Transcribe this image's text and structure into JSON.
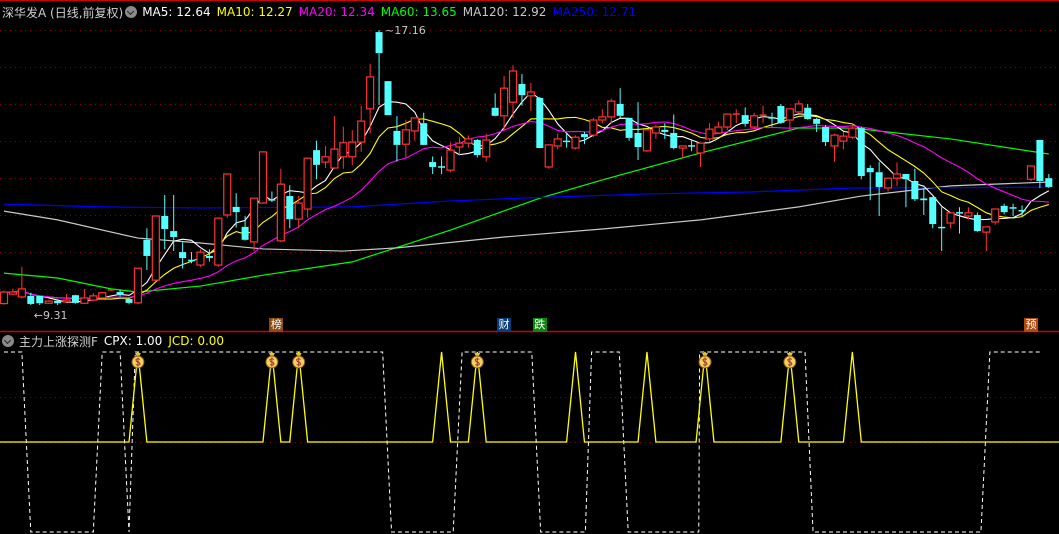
{
  "header": {
    "title": "深华发A (日线,前复权)",
    "ma_labels": [
      {
        "text": "MA5: 12.64",
        "color": "#ffffff"
      },
      {
        "text": "MA10: 12.27",
        "color": "#ffff00"
      },
      {
        "text": "MA20: 12.34",
        "color": "#ff00ff"
      },
      {
        "text": "MA60: 13.65",
        "color": "#00ff00"
      },
      {
        "text": "MA120: 12.92",
        "color": "#c8c8c8"
      },
      {
        "text": "MA250: 12.71",
        "color": "#0000ff"
      }
    ]
  },
  "indicator_header": {
    "title": "主力上涨探测F",
    "cpx": "CPX: 1.00",
    "jcd": "JCD: 0.00"
  },
  "annotations": {
    "high_label": "17.16",
    "low_label": "9.31"
  },
  "event_marks": [
    {
      "text": "榜",
      "color": "#8b4a10",
      "index": 30.5
    },
    {
      "text": "财",
      "color": "#0a3c78",
      "index": 56
    },
    {
      "text": "跌",
      "color": "#0a8a0a",
      "index": 60
    },
    {
      "text": "预",
      "color": "#b04a10",
      "index": 115
    }
  ],
  "colors": {
    "up": "#ff3232",
    "down": "#54ffff",
    "grid": "#8b0000",
    "divider": "#d00000",
    "signal": "#ffff00",
    "cpx": "#ffffff"
  },
  "chart_data": {
    "type": "candlestick",
    "y_top_price": 17.16,
    "y_low_price": 9.31,
    "grid_prices": [
      17.16,
      16.1,
      15.05,
      13.99,
      12.93,
      11.88,
      10.82,
      9.77
    ],
    "candles_ohlc": [
      [
        9.35,
        9.72,
        9.32,
        9.68
      ],
      [
        9.62,
        9.78,
        9.6,
        9.68
      ],
      [
        9.54,
        10.4,
        9.5,
        9.77
      ],
      [
        9.57,
        9.66,
        9.31,
        9.34
      ],
      [
        9.57,
        9.57,
        9.31,
        9.36
      ],
      [
        9.36,
        9.45,
        9.34,
        9.42
      ],
      [
        9.43,
        9.45,
        9.31,
        9.36
      ],
      [
        9.4,
        9.62,
        9.38,
        9.45
      ],
      [
        9.59,
        9.6,
        9.35,
        9.37
      ],
      [
        9.36,
        9.77,
        9.34,
        9.51
      ],
      [
        9.45,
        9.65,
        9.43,
        9.57
      ],
      [
        9.51,
        9.68,
        9.49,
        9.66
      ],
      [
        9.71,
        9.76,
        9.7,
        9.74
      ],
      [
        9.68,
        9.74,
        9.55,
        9.59
      ],
      [
        9.48,
        9.5,
        9.33,
        9.37
      ],
      [
        9.37,
        10.36,
        9.33,
        10.36
      ],
      [
        11.17,
        11.5,
        10.31,
        10.71
      ],
      [
        10.02,
        11.85,
        10.0,
        11.85
      ],
      [
        11.85,
        12.45,
        10.9,
        11.48
      ],
      [
        11.42,
        12.45,
        10.85,
        11.25
      ],
      [
        10.82,
        11.1,
        10.35,
        10.65
      ],
      [
        10.58,
        10.82,
        10.5,
        10.55
      ],
      [
        10.45,
        10.9,
        10.4,
        10.82
      ],
      [
        10.71,
        10.9,
        10.55,
        10.65
      ],
      [
        10.45,
        11.8,
        10.4,
        11.79
      ],
      [
        11.88,
        13.05,
        11.8,
        13.05
      ],
      [
        12.11,
        12.5,
        11.52,
        11.96
      ],
      [
        11.54,
        11.85,
        11.15,
        11.17
      ],
      [
        11.11,
        12.36,
        10.85,
        12.36
      ],
      [
        12.22,
        13.68,
        12.2,
        13.68
      ],
      [
        12.31,
        12.55,
        12.25,
        12.31
      ],
      [
        11.14,
        13.2,
        11.1,
        12.76
      ],
      [
        12.42,
        12.73,
        11.5,
        11.76
      ],
      [
        11.76,
        12.42,
        11.5,
        12.22
      ],
      [
        12.05,
        13.5,
        11.8,
        13.5
      ],
      [
        13.73,
        14.0,
        12.9,
        13.31
      ],
      [
        13.39,
        13.85,
        13.22,
        13.54
      ],
      [
        13.22,
        14.7,
        13.2,
        13.76
      ],
      [
        13.54,
        14.4,
        13.2,
        13.94
      ],
      [
        13.54,
        14.3,
        13.3,
        13.96
      ],
      [
        13.96,
        15.0,
        13.68,
        14.56
      ],
      [
        14.91,
        16.2,
        14.2,
        15.82
      ],
      [
        17.1,
        17.16,
        15.02,
        16.5
      ],
      [
        15.7,
        15.7,
        14.73,
        14.73
      ],
      [
        14.28,
        14.7,
        13.4,
        13.88
      ],
      [
        13.9,
        14.6,
        13.52,
        14.31
      ],
      [
        14.28,
        14.65,
        14.0,
        14.65
      ],
      [
        14.5,
        14.8,
        13.88,
        13.88
      ],
      [
        13.39,
        13.55,
        13.05,
        13.25
      ],
      [
        13.25,
        13.55,
        13.05,
        13.22
      ],
      [
        13.16,
        13.95,
        13.1,
        13.73
      ],
      [
        13.82,
        14.1,
        13.6,
        13.93
      ],
      [
        13.93,
        14.15,
        13.8,
        14.05
      ],
      [
        14.02,
        14.05,
        13.52,
        13.59
      ],
      [
        13.54,
        14.2,
        13.4,
        14.02
      ],
      [
        14.94,
        15.35,
        14.7,
        14.71
      ],
      [
        14.71,
        15.85,
        14.3,
        15.5
      ],
      [
        15.1,
        16.15,
        14.65,
        15.99
      ],
      [
        15.62,
        15.9,
        15.0,
        15.3
      ],
      [
        15.28,
        15.65,
        14.85,
        15.39
      ],
      [
        15.22,
        15.25,
        13.79,
        13.79
      ],
      [
        13.25,
        13.9,
        13.2,
        13.88
      ],
      [
        13.85,
        14.2,
        13.75,
        14.05
      ],
      [
        13.98,
        14.2,
        13.8,
        13.95
      ],
      [
        13.79,
        14.15,
        13.75,
        14.1
      ],
      [
        14.19,
        14.25,
        13.9,
        14.1
      ],
      [
        14.16,
        14.65,
        14.1,
        14.59
      ],
      [
        14.59,
        14.9,
        14.5,
        14.68
      ],
      [
        14.68,
        15.2,
        14.5,
        15.13
      ],
      [
        15.05,
        15.5,
        14.65,
        14.71
      ],
      [
        14.65,
        14.65,
        14.0,
        14.08
      ],
      [
        14.22,
        15.1,
        13.45,
        13.82
      ],
      [
        13.71,
        14.31,
        13.68,
        14.31
      ],
      [
        14.22,
        14.45,
        14.05,
        14.39
      ],
      [
        14.31,
        14.5,
        14.05,
        14.25
      ],
      [
        14.22,
        14.75,
        13.75,
        13.79
      ],
      [
        13.79,
        13.85,
        13.5,
        13.85
      ],
      [
        13.85,
        14.0,
        13.7,
        13.82
      ],
      [
        13.65,
        13.95,
        13.25,
        13.93
      ],
      [
        14.05,
        14.5,
        13.95,
        14.33
      ],
      [
        14.22,
        14.55,
        14.2,
        14.39
      ],
      [
        14.39,
        14.76,
        14.3,
        14.76
      ],
      [
        14.74,
        14.9,
        14.5,
        14.76
      ],
      [
        14.73,
        14.95,
        14.4,
        14.48
      ],
      [
        14.39,
        14.8,
        14.35,
        14.71
      ],
      [
        14.7,
        15.0,
        14.5,
        14.73
      ],
      [
        14.65,
        14.8,
        14.4,
        14.63
      ],
      [
        14.99,
        15.05,
        14.48,
        14.51
      ],
      [
        14.59,
        14.91,
        14.3,
        14.91
      ],
      [
        14.82,
        15.15,
        14.8,
        15.05
      ],
      [
        14.94,
        15.05,
        14.6,
        14.62
      ],
      [
        14.62,
        14.65,
        14.25,
        14.48
      ],
      [
        14.39,
        14.45,
        13.85,
        13.96
      ],
      [
        13.85,
        14.2,
        13.4,
        14.16
      ],
      [
        13.99,
        14.25,
        13.75,
        14.13
      ],
      [
        14.1,
        14.45,
        14.05,
        14.36
      ],
      [
        14.36,
        14.4,
        12.9,
        12.99
      ],
      [
        13.22,
        13.3,
        12.3,
        13.1
      ],
      [
        13.1,
        13.4,
        11.85,
        12.68
      ],
      [
        12.65,
        12.93,
        12.55,
        12.93
      ],
      [
        12.93,
        13.38,
        12.7,
        13.05
      ],
      [
        13.05,
        13.05,
        12.1,
        12.9
      ],
      [
        12.85,
        13.2,
        12.28,
        12.33
      ],
      [
        12.35,
        12.65,
        11.88,
        12.3
      ],
      [
        12.39,
        12.4,
        11.5,
        11.62
      ],
      [
        11.52,
        12.1,
        10.85,
        11.5
      ],
      [
        11.65,
        11.94,
        11.5,
        11.94
      ],
      [
        11.94,
        12.1,
        11.35,
        11.92
      ],
      [
        11.85,
        12.1,
        11.75,
        11.94
      ],
      [
        11.88,
        11.95,
        11.4,
        11.42
      ],
      [
        11.39,
        11.54,
        10.85,
        11.54
      ],
      [
        11.68,
        12.05,
        11.6,
        12.05
      ],
      [
        12.14,
        12.2,
        11.9,
        11.96
      ],
      [
        12.08,
        12.2,
        11.85,
        12.05
      ],
      [
        12.0,
        12.15,
        11.85,
        12.0
      ],
      [
        12.9,
        13.28,
        12.85,
        13.28
      ],
      [
        14.02,
        14.02,
        12.65,
        12.85
      ],
      [
        12.93,
        13.05,
        12.65,
        12.68
      ]
    ],
    "ma_long": {
      "MA60": [
        [
          0,
          10.22
        ],
        [
          6,
          10.08
        ],
        [
          12,
          9.77
        ],
        [
          15,
          9.68
        ],
        [
          22,
          9.85
        ],
        [
          29,
          10.16
        ],
        [
          39,
          10.54
        ],
        [
          50,
          11.45
        ],
        [
          60,
          12.36
        ],
        [
          67,
          12.88
        ],
        [
          78,
          13.65
        ],
        [
          89,
          14.36
        ],
        [
          95,
          14.36
        ],
        [
          106,
          14.05
        ],
        [
          117,
          13.62
        ]
      ],
      "MA120": [
        [
          0,
          11.99
        ],
        [
          6,
          11.74
        ],
        [
          15,
          11.22
        ],
        [
          22,
          11.08
        ],
        [
          29,
          10.91
        ],
        [
          38,
          10.85
        ],
        [
          44,
          10.94
        ],
        [
          56,
          11.25
        ],
        [
          67,
          11.48
        ],
        [
          78,
          11.74
        ],
        [
          89,
          12.11
        ],
        [
          96,
          12.42
        ],
        [
          106,
          12.71
        ],
        [
          117,
          12.82
        ]
      ],
      "MA250": [
        [
          0,
          12.19
        ],
        [
          11,
          12.11
        ],
        [
          22,
          12.08
        ],
        [
          39,
          12.11
        ],
        [
          50,
          12.28
        ],
        [
          61,
          12.39
        ],
        [
          72,
          12.48
        ],
        [
          84,
          12.54
        ],
        [
          95,
          12.65
        ],
        [
          117,
          12.67
        ]
      ]
    },
    "ma_short_periods": {
      "MA5": 5,
      "MA10": 10,
      "MA20": 20
    },
    "indicator": {
      "signal_spikes": [
        15,
        30,
        33,
        49,
        53,
        64,
        72,
        78.5,
        88,
        95
      ],
      "money_bag_signals": [
        15,
        30,
        33,
        53,
        78.5,
        88
      ],
      "cpx_steps": [
        [
          0,
          1
        ],
        [
          2,
          1
        ],
        [
          3,
          0
        ],
        [
          10,
          0
        ],
        [
          11,
          1
        ],
        [
          13,
          1
        ],
        [
          14,
          0
        ],
        [
          14.7,
          1
        ],
        [
          42.4,
          1
        ],
        [
          43.4,
          0
        ],
        [
          50.3,
          0
        ],
        [
          51.3,
          1
        ],
        [
          59.1,
          1
        ],
        [
          60.1,
          0
        ],
        [
          65.1,
          0
        ],
        [
          65.8,
          1
        ],
        [
          68.9,
          1
        ],
        [
          69.9,
          0
        ],
        [
          77.8,
          0
        ],
        [
          77.9,
          1
        ],
        [
          89.7,
          1
        ],
        [
          90.6,
          0
        ],
        [
          109.4,
          0
        ],
        [
          110.4,
          1
        ],
        [
          116.1,
          1
        ]
      ]
    }
  }
}
